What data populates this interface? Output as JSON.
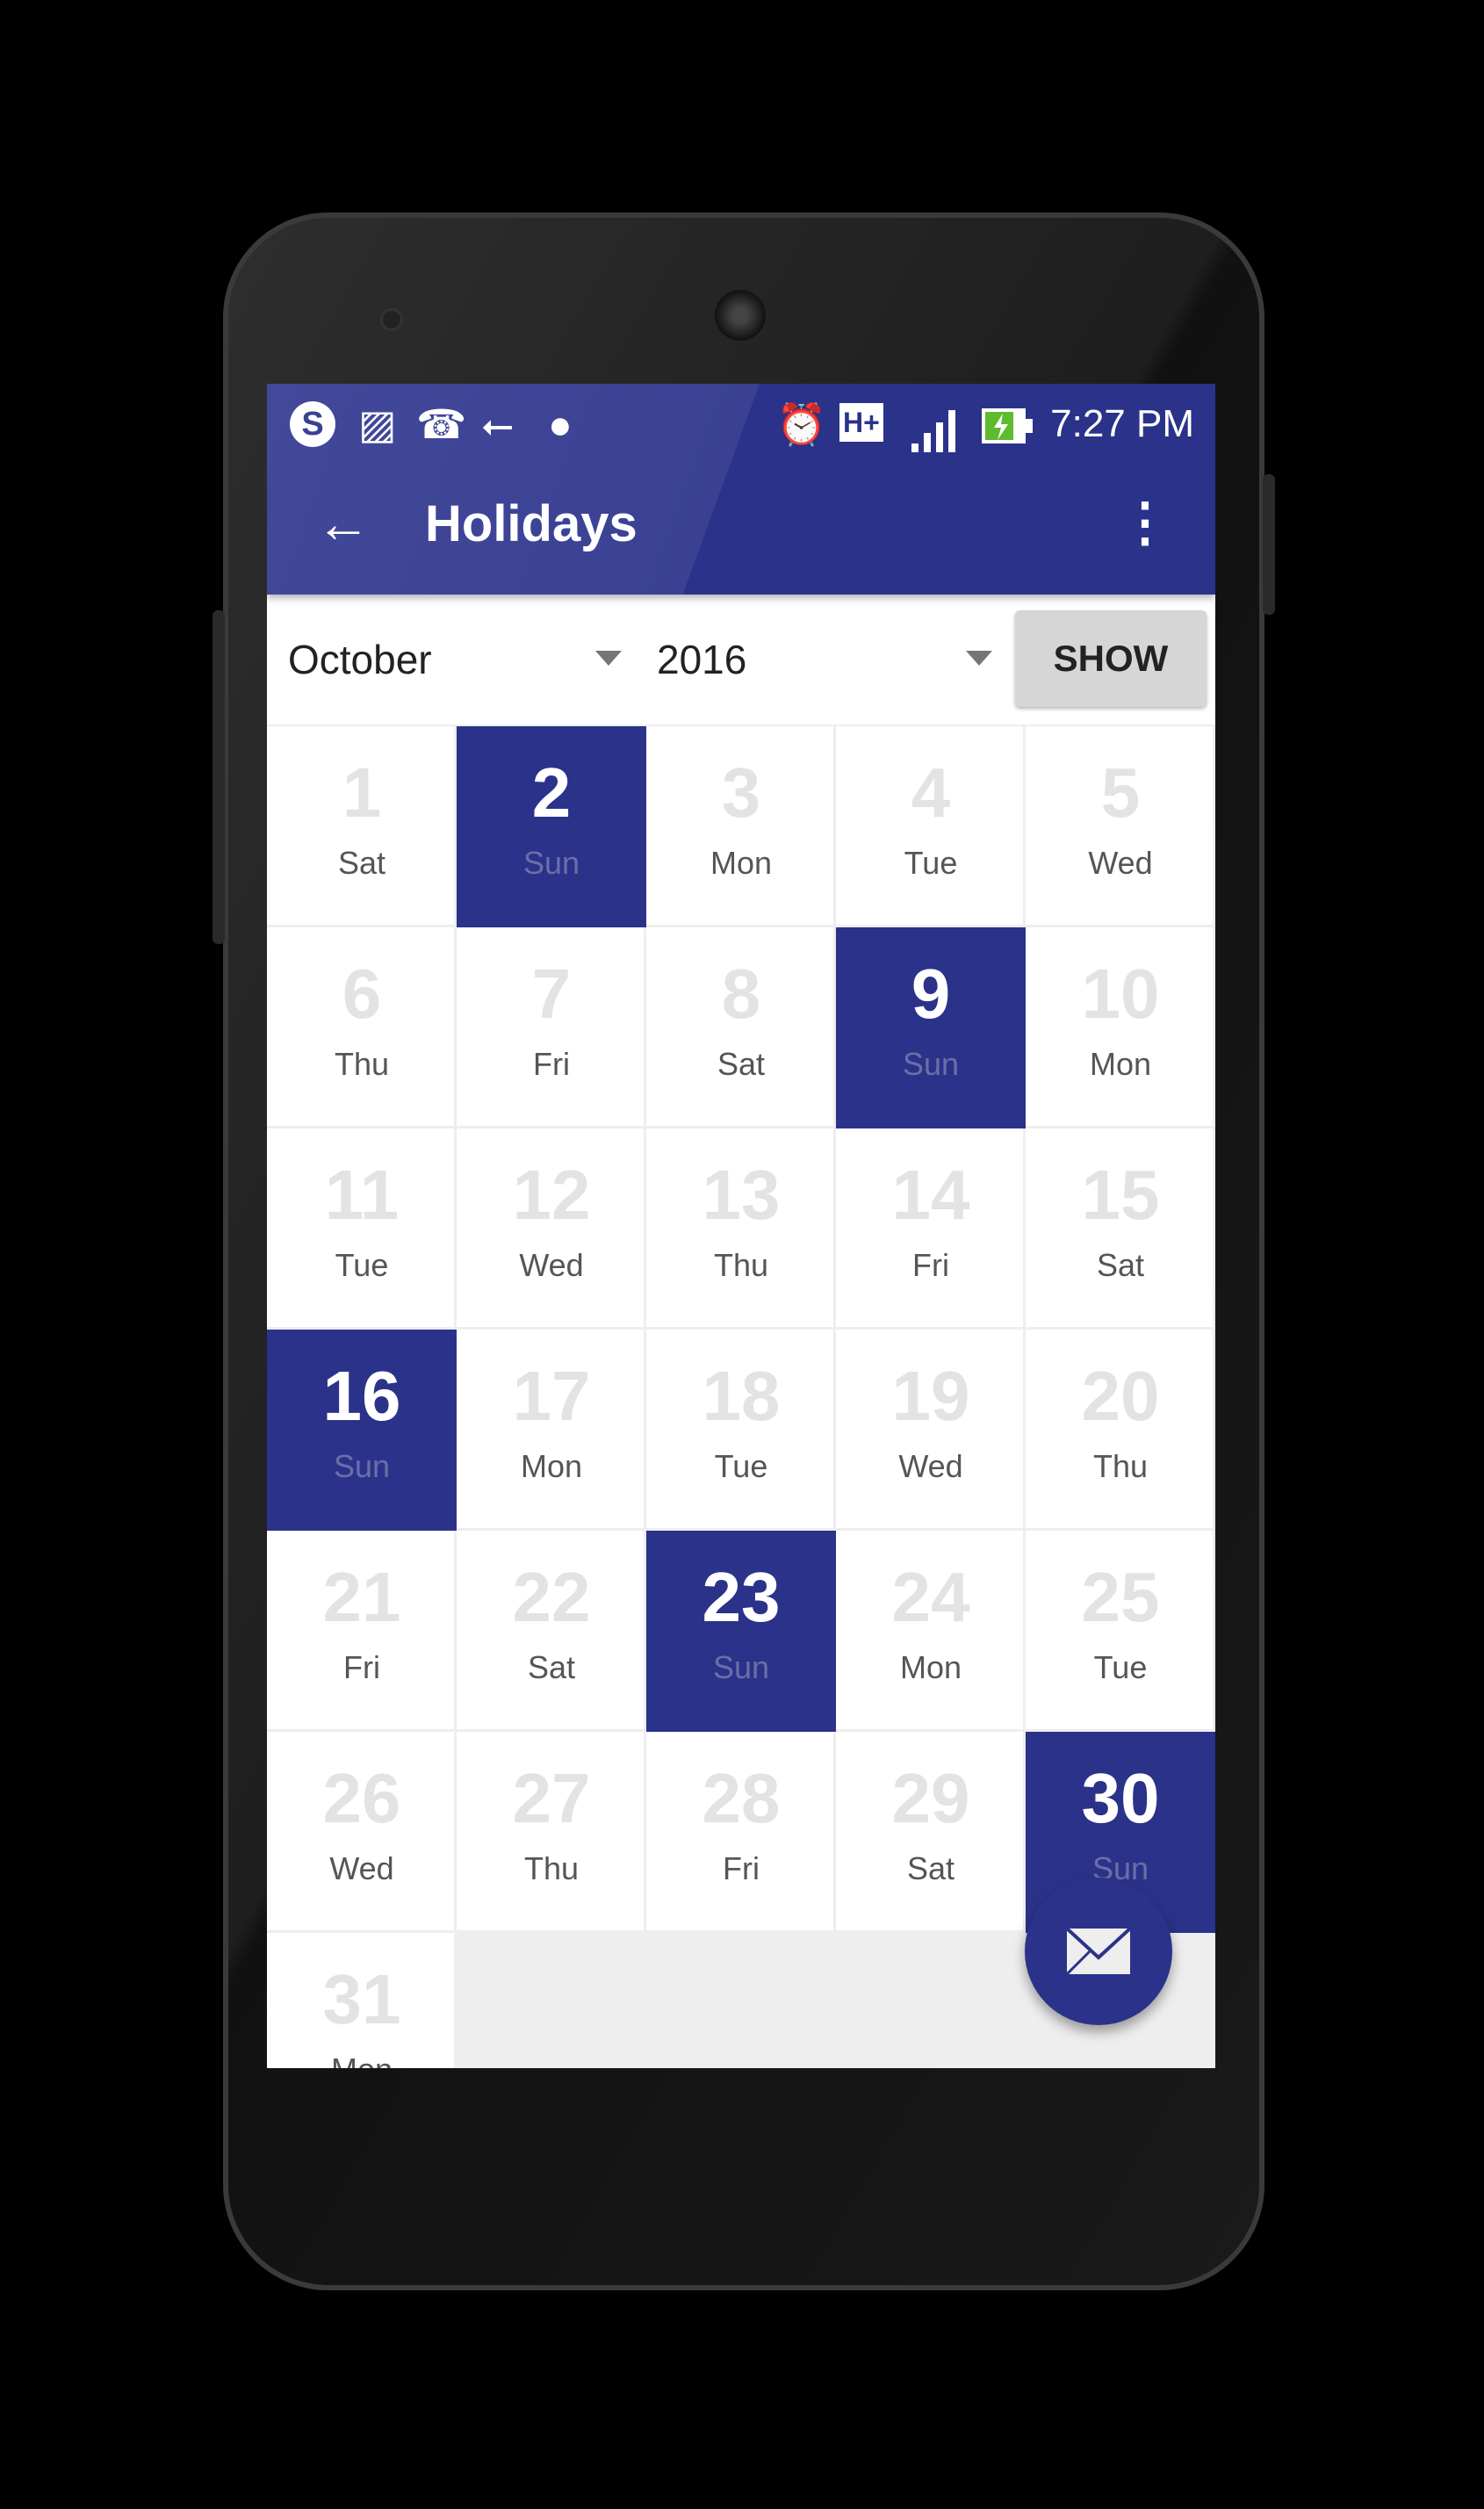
{
  "status_bar": {
    "left_icons": [
      "skype-icon",
      "image-icon",
      "missed-call-icon",
      "usb-icon",
      "android-debug-icon"
    ],
    "right_icons": [
      "alarm-icon",
      "hplus-network-icon",
      "signal-icon",
      "battery-charging-icon"
    ],
    "network_label": "H+",
    "time": "7:27 PM"
  },
  "toolbar": {
    "title": "Holidays",
    "back_icon": "arrow-left-icon",
    "menu_icon": "more-vert-icon"
  },
  "filters": {
    "month": "October",
    "year": "2016",
    "show_label": "SHOW"
  },
  "colors": {
    "primary": "#2b3289",
    "empty_number": "#e3e3e3",
    "background": "#eeeeee"
  },
  "calendar": {
    "days": [
      {
        "day": "1",
        "dow": "Sat",
        "holiday": false
      },
      {
        "day": "2",
        "dow": "Sun",
        "holiday": true
      },
      {
        "day": "3",
        "dow": "Mon",
        "holiday": false
      },
      {
        "day": "4",
        "dow": "Tue",
        "holiday": false
      },
      {
        "day": "5",
        "dow": "Wed",
        "holiday": false
      },
      {
        "day": "6",
        "dow": "Thu",
        "holiday": false
      },
      {
        "day": "7",
        "dow": "Fri",
        "holiday": false
      },
      {
        "day": "8",
        "dow": "Sat",
        "holiday": false
      },
      {
        "day": "9",
        "dow": "Sun",
        "holiday": true
      },
      {
        "day": "10",
        "dow": "Mon",
        "holiday": false
      },
      {
        "day": "11",
        "dow": "Tue",
        "holiday": false
      },
      {
        "day": "12",
        "dow": "Wed",
        "holiday": false
      },
      {
        "day": "13",
        "dow": "Thu",
        "holiday": false
      },
      {
        "day": "14",
        "dow": "Fri",
        "holiday": false
      },
      {
        "day": "15",
        "dow": "Sat",
        "holiday": false
      },
      {
        "day": "16",
        "dow": "Sun",
        "holiday": true
      },
      {
        "day": "17",
        "dow": "Mon",
        "holiday": false
      },
      {
        "day": "18",
        "dow": "Tue",
        "holiday": false
      },
      {
        "day": "19",
        "dow": "Wed",
        "holiday": false
      },
      {
        "day": "20",
        "dow": "Thu",
        "holiday": false
      },
      {
        "day": "21",
        "dow": "Fri",
        "holiday": false
      },
      {
        "day": "22",
        "dow": "Sat",
        "holiday": false
      },
      {
        "day": "23",
        "dow": "Sun",
        "holiday": true
      },
      {
        "day": "24",
        "dow": "Mon",
        "holiday": false
      },
      {
        "day": "25",
        "dow": "Tue",
        "holiday": false
      },
      {
        "day": "26",
        "dow": "Wed",
        "holiday": false
      },
      {
        "day": "27",
        "dow": "Thu",
        "holiday": false
      },
      {
        "day": "28",
        "dow": "Fri",
        "holiday": false
      },
      {
        "day": "29",
        "dow": "Sat",
        "holiday": false
      },
      {
        "day": "30",
        "dow": "Sun",
        "holiday": true
      },
      {
        "day": "31",
        "dow": "Mon",
        "holiday": false
      }
    ]
  },
  "fab": {
    "icon": "envelope-icon"
  }
}
